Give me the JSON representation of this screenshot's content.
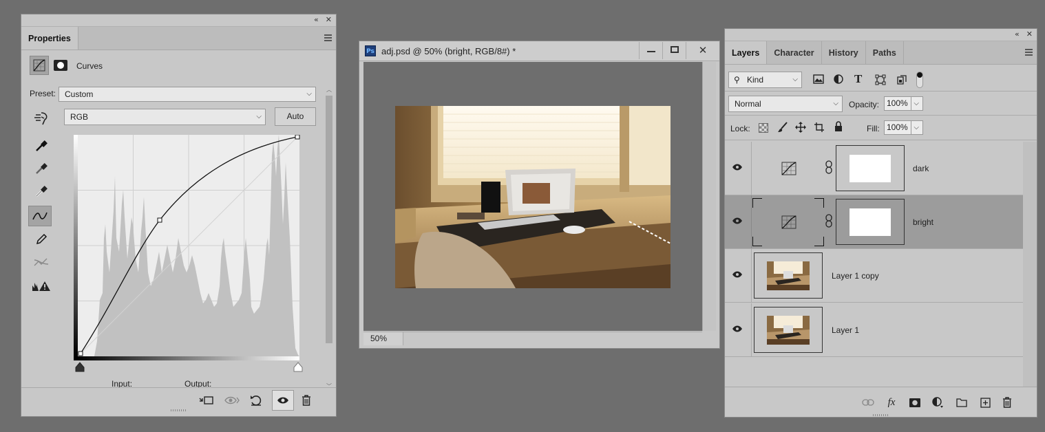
{
  "properties": {
    "tab_label": "Properties",
    "adjustment_name": "Curves",
    "preset_label": "Preset:",
    "preset_value": "Custom",
    "channel_value": "RGB",
    "auto_label": "Auto",
    "input_label": "Input:",
    "output_label": "Output:"
  },
  "document": {
    "title": "adj.psd @ 50% (bright, RGB/8#) *",
    "app_badge": "Ps",
    "zoom": "50%"
  },
  "layers_panel": {
    "tabs": [
      "Layers",
      "Character",
      "History",
      "Paths"
    ],
    "filter_value": "Kind",
    "blend_mode": "Normal",
    "opacity_label": "Opacity:",
    "opacity_value": "100%",
    "lock_label": "Lock:",
    "fill_label": "Fill:",
    "fill_value": "100%",
    "layers": [
      {
        "name": "dark",
        "type": "curves-adjustment",
        "visible": true,
        "selected": false
      },
      {
        "name": "bright",
        "type": "curves-adjustment",
        "visible": true,
        "selected": true
      },
      {
        "name": "Layer 1 copy",
        "type": "pixel",
        "visible": true,
        "selected": false
      },
      {
        "name": "Layer 1",
        "type": "pixel",
        "visible": true,
        "selected": false
      }
    ]
  },
  "colors": {
    "workspace": "#6e6e6e",
    "panel": "#c8c8c8",
    "selected_row": "#9c9c9c",
    "ps_badge": "#1f3f7a"
  }
}
